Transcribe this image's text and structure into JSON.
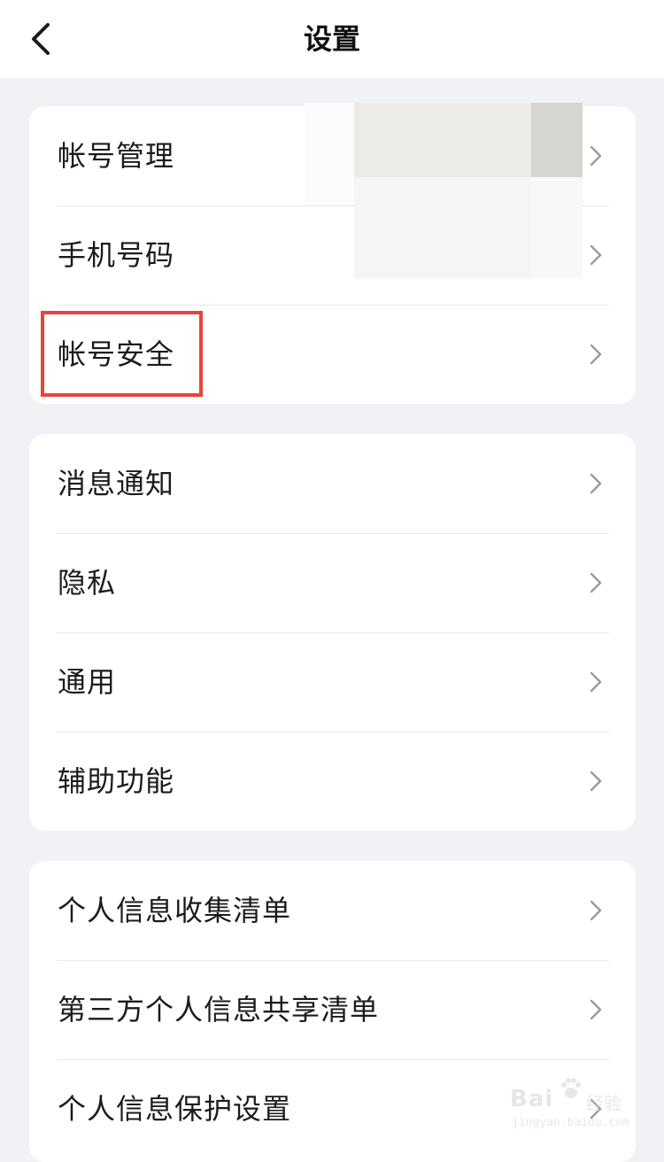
{
  "header": {
    "title": "设置",
    "back_icon": "chevron-left-icon"
  },
  "groups": [
    {
      "items": [
        {
          "label": "帐号管理"
        },
        {
          "label": "手机号码"
        },
        {
          "label": "帐号安全",
          "highlighted": true
        }
      ]
    },
    {
      "items": [
        {
          "label": "消息通知"
        },
        {
          "label": "隐私"
        },
        {
          "label": "通用"
        },
        {
          "label": "辅助功能"
        }
      ]
    },
    {
      "items": [
        {
          "label": "个人信息收集清单"
        },
        {
          "label": "第三方个人信息共享清单"
        },
        {
          "label": "个人信息保护设置"
        }
      ]
    }
  ],
  "colors": {
    "background": "#f1f2f6",
    "card": "#ffffff",
    "highlight": "#e5453b",
    "chevron": "#9a9a9e"
  },
  "watermark": {
    "brand": "Bai",
    "brand_suffix": "经验",
    "url": "jingyan.baidu.com"
  }
}
